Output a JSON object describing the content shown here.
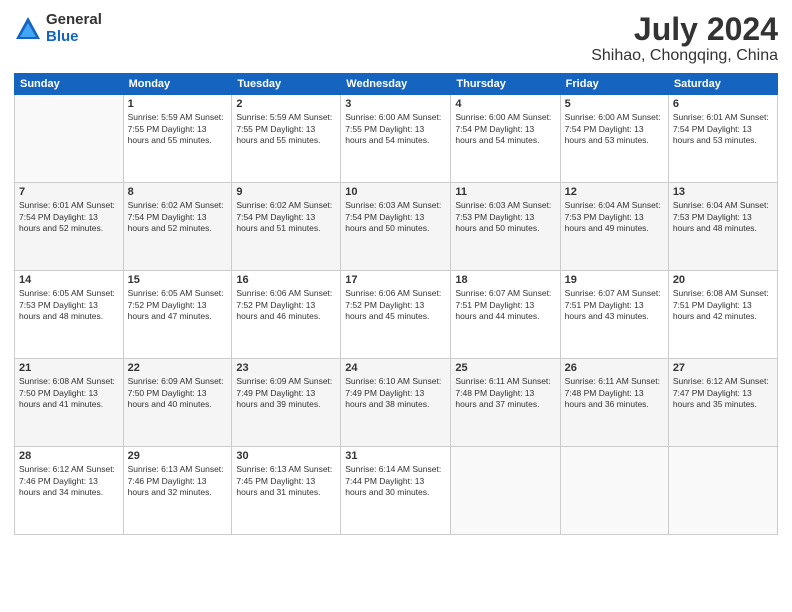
{
  "logo": {
    "general": "General",
    "blue": "Blue"
  },
  "title": {
    "month_year": "July 2024",
    "location": "Shihao, Chongqing, China"
  },
  "days_of_week": [
    "Sunday",
    "Monday",
    "Tuesday",
    "Wednesday",
    "Thursday",
    "Friday",
    "Saturday"
  ],
  "weeks": [
    [
      {
        "day": "",
        "info": ""
      },
      {
        "day": "1",
        "info": "Sunrise: 5:59 AM\nSunset: 7:55 PM\nDaylight: 13 hours\nand 55 minutes."
      },
      {
        "day": "2",
        "info": "Sunrise: 5:59 AM\nSunset: 7:55 PM\nDaylight: 13 hours\nand 55 minutes."
      },
      {
        "day": "3",
        "info": "Sunrise: 6:00 AM\nSunset: 7:55 PM\nDaylight: 13 hours\nand 54 minutes."
      },
      {
        "day": "4",
        "info": "Sunrise: 6:00 AM\nSunset: 7:54 PM\nDaylight: 13 hours\nand 54 minutes."
      },
      {
        "day": "5",
        "info": "Sunrise: 6:00 AM\nSunset: 7:54 PM\nDaylight: 13 hours\nand 53 minutes."
      },
      {
        "day": "6",
        "info": "Sunrise: 6:01 AM\nSunset: 7:54 PM\nDaylight: 13 hours\nand 53 minutes."
      }
    ],
    [
      {
        "day": "7",
        "info": "Sunrise: 6:01 AM\nSunset: 7:54 PM\nDaylight: 13 hours\nand 52 minutes."
      },
      {
        "day": "8",
        "info": "Sunrise: 6:02 AM\nSunset: 7:54 PM\nDaylight: 13 hours\nand 52 minutes."
      },
      {
        "day": "9",
        "info": "Sunrise: 6:02 AM\nSunset: 7:54 PM\nDaylight: 13 hours\nand 51 minutes."
      },
      {
        "day": "10",
        "info": "Sunrise: 6:03 AM\nSunset: 7:54 PM\nDaylight: 13 hours\nand 50 minutes."
      },
      {
        "day": "11",
        "info": "Sunrise: 6:03 AM\nSunset: 7:53 PM\nDaylight: 13 hours\nand 50 minutes."
      },
      {
        "day": "12",
        "info": "Sunrise: 6:04 AM\nSunset: 7:53 PM\nDaylight: 13 hours\nand 49 minutes."
      },
      {
        "day": "13",
        "info": "Sunrise: 6:04 AM\nSunset: 7:53 PM\nDaylight: 13 hours\nand 48 minutes."
      }
    ],
    [
      {
        "day": "14",
        "info": "Sunrise: 6:05 AM\nSunset: 7:53 PM\nDaylight: 13 hours\nand 48 minutes."
      },
      {
        "day": "15",
        "info": "Sunrise: 6:05 AM\nSunset: 7:52 PM\nDaylight: 13 hours\nand 47 minutes."
      },
      {
        "day": "16",
        "info": "Sunrise: 6:06 AM\nSunset: 7:52 PM\nDaylight: 13 hours\nand 46 minutes."
      },
      {
        "day": "17",
        "info": "Sunrise: 6:06 AM\nSunset: 7:52 PM\nDaylight: 13 hours\nand 45 minutes."
      },
      {
        "day": "18",
        "info": "Sunrise: 6:07 AM\nSunset: 7:51 PM\nDaylight: 13 hours\nand 44 minutes."
      },
      {
        "day": "19",
        "info": "Sunrise: 6:07 AM\nSunset: 7:51 PM\nDaylight: 13 hours\nand 43 minutes."
      },
      {
        "day": "20",
        "info": "Sunrise: 6:08 AM\nSunset: 7:51 PM\nDaylight: 13 hours\nand 42 minutes."
      }
    ],
    [
      {
        "day": "21",
        "info": "Sunrise: 6:08 AM\nSunset: 7:50 PM\nDaylight: 13 hours\nand 41 minutes."
      },
      {
        "day": "22",
        "info": "Sunrise: 6:09 AM\nSunset: 7:50 PM\nDaylight: 13 hours\nand 40 minutes."
      },
      {
        "day": "23",
        "info": "Sunrise: 6:09 AM\nSunset: 7:49 PM\nDaylight: 13 hours\nand 39 minutes."
      },
      {
        "day": "24",
        "info": "Sunrise: 6:10 AM\nSunset: 7:49 PM\nDaylight: 13 hours\nand 38 minutes."
      },
      {
        "day": "25",
        "info": "Sunrise: 6:11 AM\nSunset: 7:48 PM\nDaylight: 13 hours\nand 37 minutes."
      },
      {
        "day": "26",
        "info": "Sunrise: 6:11 AM\nSunset: 7:48 PM\nDaylight: 13 hours\nand 36 minutes."
      },
      {
        "day": "27",
        "info": "Sunrise: 6:12 AM\nSunset: 7:47 PM\nDaylight: 13 hours\nand 35 minutes."
      }
    ],
    [
      {
        "day": "28",
        "info": "Sunrise: 6:12 AM\nSunset: 7:46 PM\nDaylight: 13 hours\nand 34 minutes."
      },
      {
        "day": "29",
        "info": "Sunrise: 6:13 AM\nSunset: 7:46 PM\nDaylight: 13 hours\nand 32 minutes."
      },
      {
        "day": "30",
        "info": "Sunrise: 6:13 AM\nSunset: 7:45 PM\nDaylight: 13 hours\nand 31 minutes."
      },
      {
        "day": "31",
        "info": "Sunrise: 6:14 AM\nSunset: 7:44 PM\nDaylight: 13 hours\nand 30 minutes."
      },
      {
        "day": "",
        "info": ""
      },
      {
        "day": "",
        "info": ""
      },
      {
        "day": "",
        "info": ""
      }
    ]
  ]
}
